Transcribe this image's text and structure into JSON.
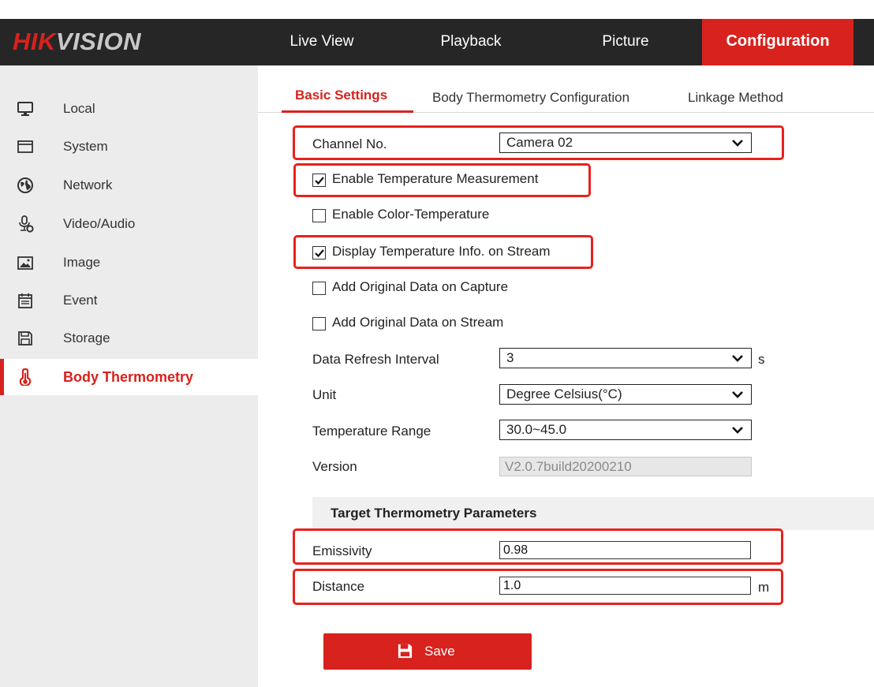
{
  "brand": {
    "hik": "HIK",
    "vision": "VISION"
  },
  "nav": {
    "live_view": "Live View",
    "playback": "Playback",
    "picture": "Picture",
    "configuration": "Configuration"
  },
  "sidebar": {
    "items": [
      {
        "label": "Local",
        "icon": "monitor-icon"
      },
      {
        "label": "System",
        "icon": "window-icon"
      },
      {
        "label": "Network",
        "icon": "globe-icon"
      },
      {
        "label": "Video/Audio",
        "icon": "microphone-icon"
      },
      {
        "label": "Image",
        "icon": "image-icon"
      },
      {
        "label": "Event",
        "icon": "calendar-icon"
      },
      {
        "label": "Storage",
        "icon": "floppy-icon"
      },
      {
        "label": "Body Thermometry",
        "icon": "thermometer-icon",
        "active": true
      }
    ]
  },
  "tabs": {
    "basic": "Basic Settings",
    "body_thermo": "Body Thermometry Configuration",
    "linkage": "Linkage Method"
  },
  "form": {
    "channel_label": "Channel No.",
    "channel_value": "Camera 02",
    "enable_temp_label": "Enable Temperature Measurement",
    "enable_temp_checked": true,
    "enable_color_label": "Enable Color-Temperature",
    "enable_color_checked": false,
    "display_info_label": "Display Temperature Info. on Stream",
    "display_info_checked": true,
    "add_capture_label": "Add Original Data on Capture",
    "add_capture_checked": false,
    "add_stream_label": "Add Original Data on Stream",
    "add_stream_checked": false,
    "refresh_label": "Data Refresh Interval",
    "refresh_value": "3",
    "refresh_unit": "s",
    "unit_label": "Unit",
    "unit_value": "Degree Celsius(°C)",
    "range_label": "Temperature Range",
    "range_value": "30.0~45.0",
    "version_label": "Version",
    "version_value": "V2.0.7build20200210"
  },
  "target": {
    "title": "Target Thermometry Parameters",
    "emissivity_label": "Emissivity",
    "emissivity_value": "0.98",
    "distance_label": "Distance",
    "distance_value": "1.0",
    "distance_unit": "m"
  },
  "save_label": "Save",
  "colors": {
    "accent": "#d7221d",
    "topbar": "#262626",
    "sidebar": "#ececec",
    "highlight": "#e8211c"
  }
}
